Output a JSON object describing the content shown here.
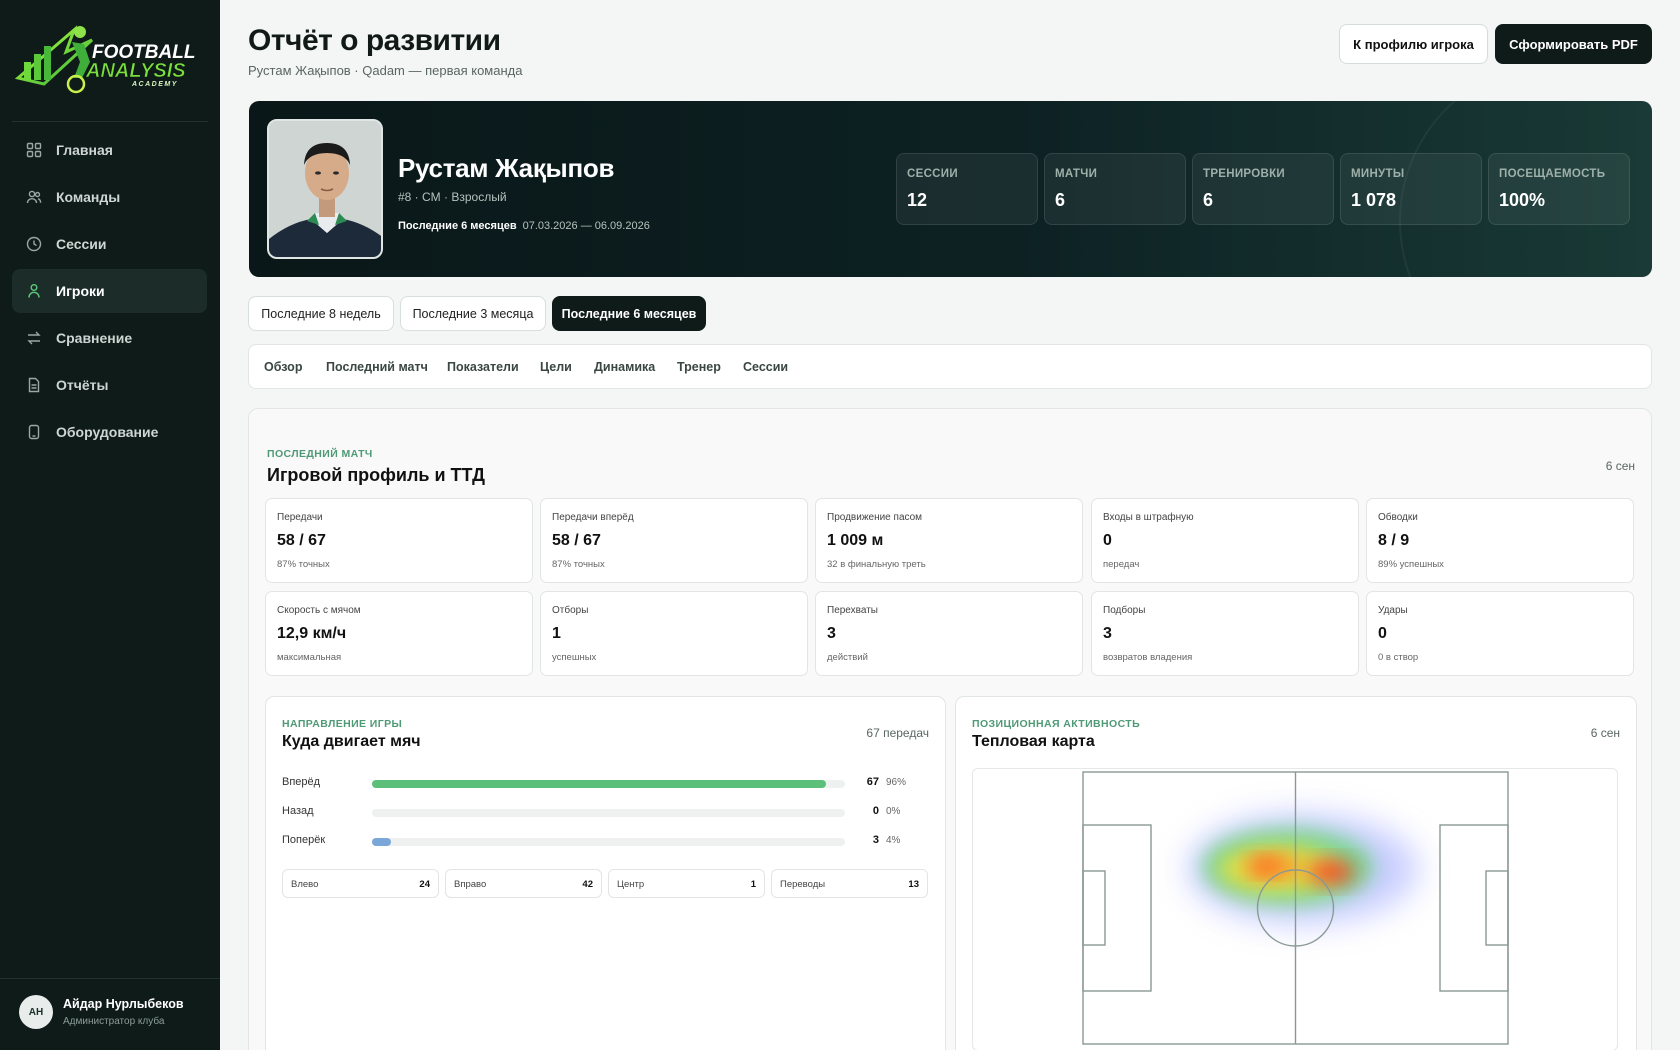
{
  "brand": {
    "line1": "FOOTBALL",
    "line2": "ANALYSIS",
    "line3": "ACADEMY"
  },
  "sidebar": {
    "items": [
      {
        "label": "Главная",
        "icon": "grid-icon"
      },
      {
        "label": "Команды",
        "icon": "users-icon"
      },
      {
        "label": "Сессии",
        "icon": "clock-icon"
      },
      {
        "label": "Игроки",
        "icon": "user-icon",
        "active": true
      },
      {
        "label": "Сравнение",
        "icon": "compare-icon"
      },
      {
        "label": "Отчёты",
        "icon": "document-icon"
      },
      {
        "label": "Оборудование",
        "icon": "device-icon"
      }
    ]
  },
  "user": {
    "initials": "АН",
    "name": "Айдар Нурлыбеков",
    "role": "Администратор клуба"
  },
  "header": {
    "title": "Отчёт о развитии",
    "subtitle": "Рустам Жақыпов · Qadam — первая команда",
    "profile_button": "К профилю игрока",
    "pdf_button": "Сформировать PDF"
  },
  "player": {
    "name": "Рустам Жақыпов",
    "meta": "#8 · CM · Взрослый",
    "period_label": "Последние 6 месяцев",
    "period_range": "07.03.2026 — 06.09.2026",
    "stats": [
      {
        "label": "СЕССИИ",
        "value": "12"
      },
      {
        "label": "МАТЧИ",
        "value": "6"
      },
      {
        "label": "ТРЕНИРОВКИ",
        "value": "6"
      },
      {
        "label": "МИНУТЫ",
        "value": "1 078"
      },
      {
        "label": "ПОСЕЩАЕМОСТЬ",
        "value": "100%"
      }
    ]
  },
  "period_tabs": [
    {
      "label": "Последние 8 недель",
      "active": false
    },
    {
      "label": "Последние 3 месяца",
      "active": false
    },
    {
      "label": "Последние 6 месяцев",
      "active": true
    }
  ],
  "subnav": [
    "Обзор",
    "Последний матч",
    "Показатели",
    "Цели",
    "Динамика",
    "Тренер",
    "Сессии"
  ],
  "last_match": {
    "eyebrow": "ПОСЛЕДНИЙ МАТЧ",
    "title": "Игровой профиль и ТТД",
    "date": "6 сен",
    "cards": [
      {
        "label": "Передачи",
        "value": "58 / 67",
        "sub": "87% точных"
      },
      {
        "label": "Передачи вперёд",
        "value": "58 / 67",
        "sub": "87% точных"
      },
      {
        "label": "Продвижение пасом",
        "value": "1 009 м",
        "sub": "32 в финальную треть"
      },
      {
        "label": "Входы в штрафную",
        "value": "0",
        "sub": "передач"
      },
      {
        "label": "Обводки",
        "value": "8 / 9",
        "sub": "89% успешных"
      },
      {
        "label": "Скорость с мячом",
        "value": "12,9 км/ч",
        "sub": "максимальная"
      },
      {
        "label": "Отборы",
        "value": "1",
        "sub": "успешных"
      },
      {
        "label": "Перехваты",
        "value": "3",
        "sub": "действий"
      },
      {
        "label": "Подборы",
        "value": "3",
        "sub": "возвратов владения"
      },
      {
        "label": "Удары",
        "value": "0",
        "sub": "0 в створ"
      }
    ]
  },
  "direction": {
    "eyebrow": "НАПРАВЛЕНИЕ ИГРЫ",
    "title": "Куда двигает мяч",
    "total": "67 передач",
    "rows": [
      {
        "label": "Вперёд",
        "count": "67",
        "pct": "96%",
        "fraction": 0.96,
        "color": "#5cbf7a"
      },
      {
        "label": "Назад",
        "count": "0",
        "pct": "0%",
        "fraction": 0.0,
        "color": "#5cbf7a"
      },
      {
        "label": "Поперёк",
        "count": "3",
        "pct": "4%",
        "fraction": 0.04,
        "color": "#7aa7d8"
      }
    ],
    "chips": [
      {
        "label": "Влево",
        "value": "24"
      },
      {
        "label": "Вправо",
        "value": "42"
      },
      {
        "label": "Центр",
        "value": "1"
      },
      {
        "label": "Переводы",
        "value": "13"
      }
    ]
  },
  "heatmap": {
    "eyebrow": "ПОЗИЦИОННАЯ АКТИВНОСТЬ",
    "title": "Тепловая карта",
    "date": "6 сен"
  }
}
